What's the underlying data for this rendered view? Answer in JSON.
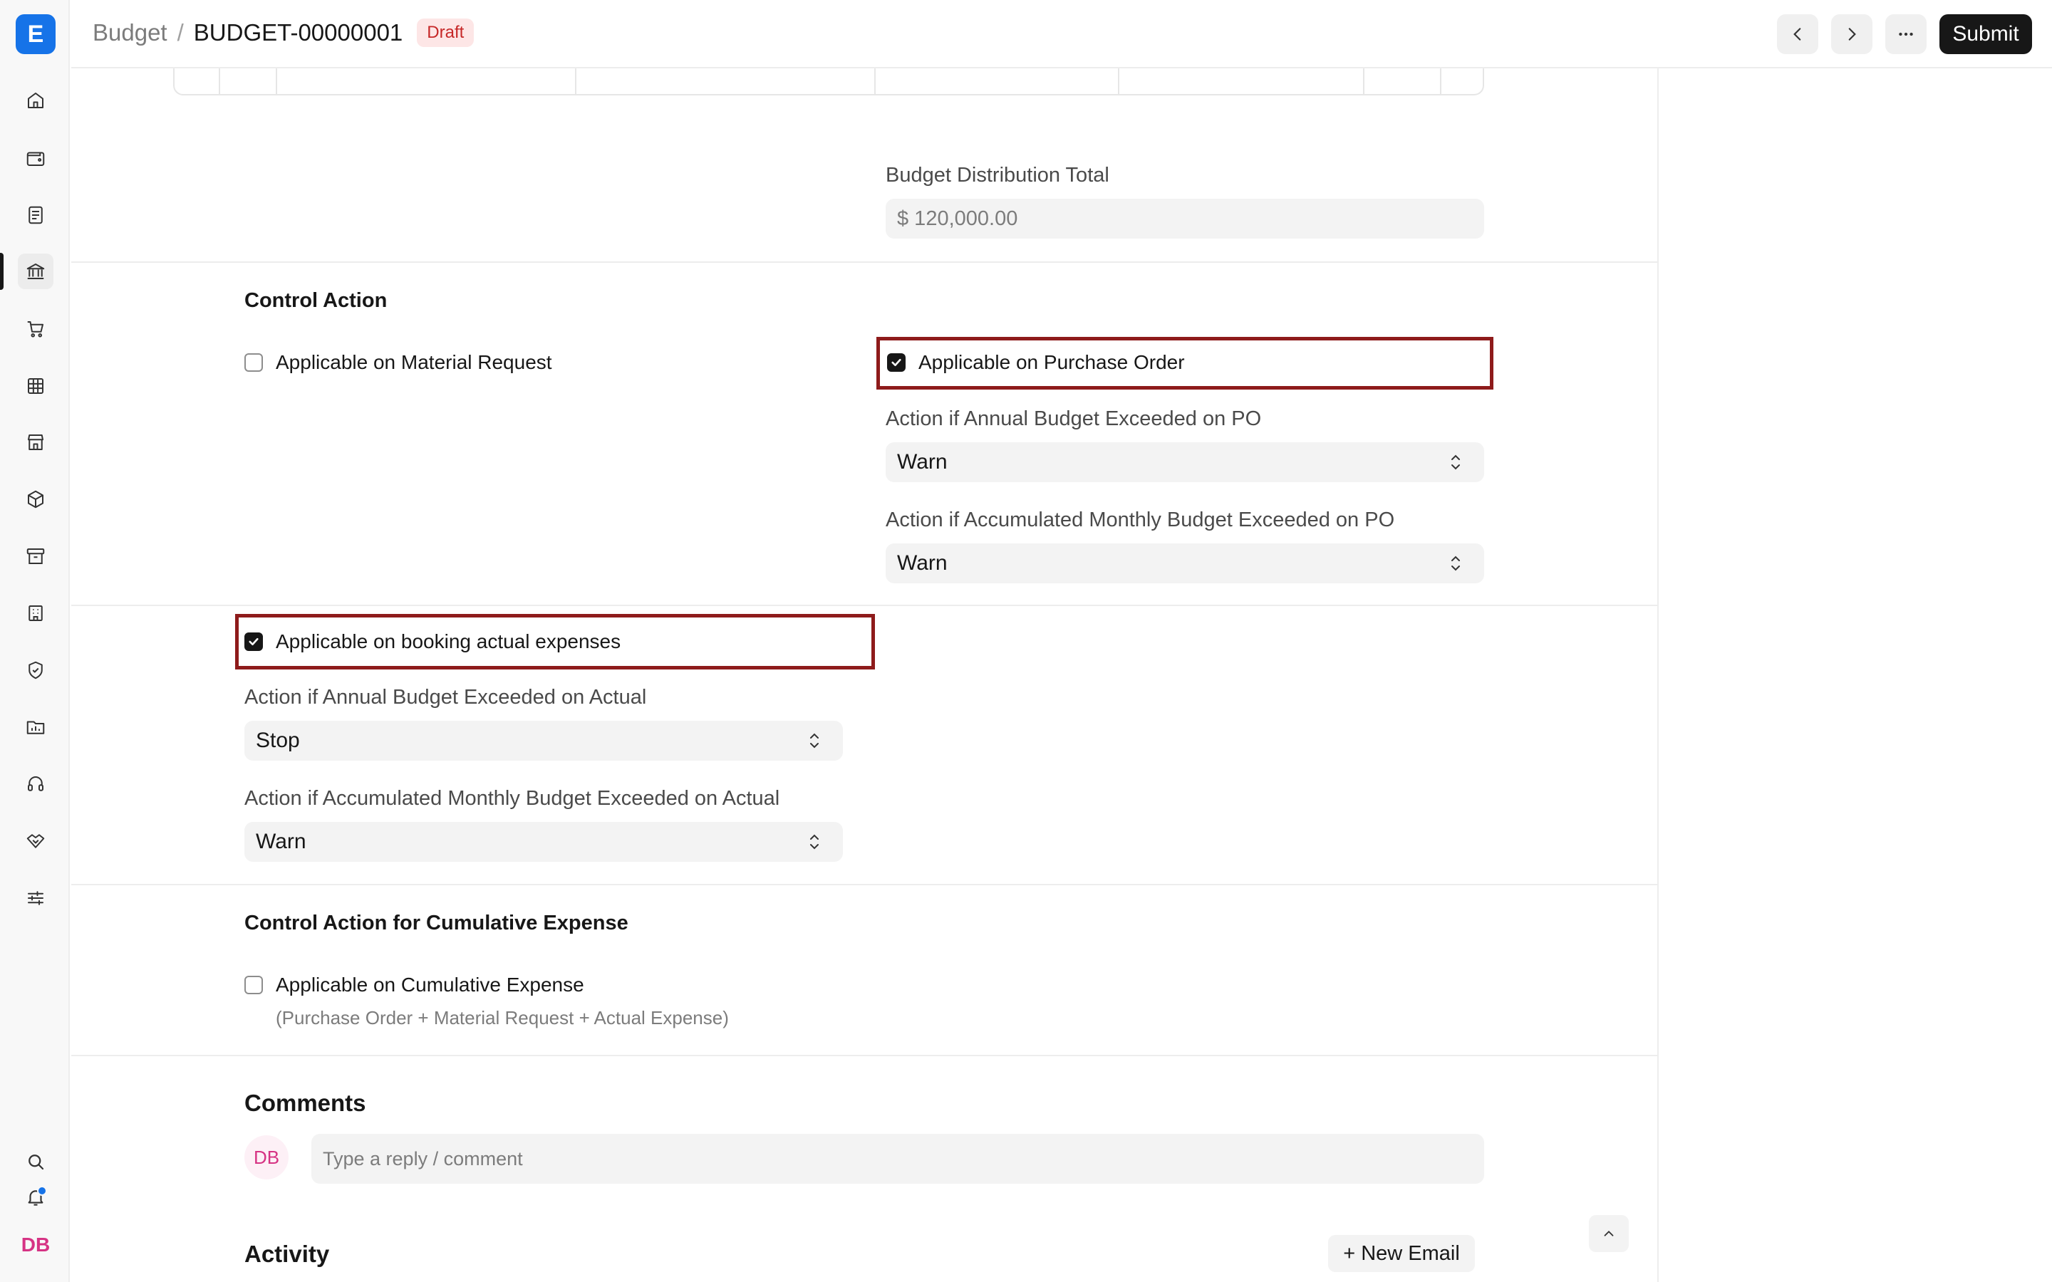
{
  "app": {
    "logo_letter": "E",
    "accent_color": "#1673e8",
    "highlight_color": "#8e1b1b"
  },
  "sidebar": {
    "icons": [
      "home-icon",
      "wallet-icon",
      "document-icon",
      "bank-icon",
      "cart-icon",
      "table-icon",
      "store-icon",
      "box-icon",
      "archive-icon",
      "building-icon",
      "shield-icon",
      "chart-folder-icon",
      "headset-icon",
      "handshake-icon",
      "sliders-icon"
    ],
    "active_icon": "bank-icon",
    "bottom_icons": [
      "search-icon",
      "bell-icon"
    ],
    "user_initials": "DB"
  },
  "header": {
    "breadcrumb_parent": "Budget",
    "breadcrumb_separator": "/",
    "document_id": "BUDGET-00000001",
    "status_badge": "Draft",
    "submit_label": "Submit"
  },
  "distribution": {
    "total_label": "Budget Distribution Total",
    "total_value": "$ 120,000.00"
  },
  "control_action": {
    "title": "Control Action",
    "material_request_label": "Applicable on Material Request",
    "material_request_checked": false,
    "purchase_order_label": "Applicable on Purchase Order",
    "purchase_order_checked": true,
    "annual_po_label": "Action if Annual Budget Exceeded on PO",
    "annual_po_value": "Warn",
    "monthly_po_label": "Action if Accumulated Monthly Budget Exceeded on PO",
    "monthly_po_value": "Warn"
  },
  "actual_expenses": {
    "checkbox_label": "Applicable on booking actual expenses",
    "checked": true,
    "annual_actual_label": "Action if Annual Budget Exceeded on Actual",
    "annual_actual_value": "Stop",
    "monthly_actual_label": "Action if Accumulated Monthly Budget Exceeded on Actual",
    "monthly_actual_value": "Warn"
  },
  "cumulative": {
    "title": "Control Action for Cumulative Expense",
    "checkbox_label": "Applicable on Cumulative Expense",
    "checked": false,
    "hint": "(Purchase Order + Material Request + Actual Expense)"
  },
  "comments": {
    "title": "Comments",
    "avatar_initials": "DB",
    "placeholder": "Type a reply / comment"
  },
  "activity": {
    "title": "Activity",
    "new_email_label": "+ New Email"
  }
}
